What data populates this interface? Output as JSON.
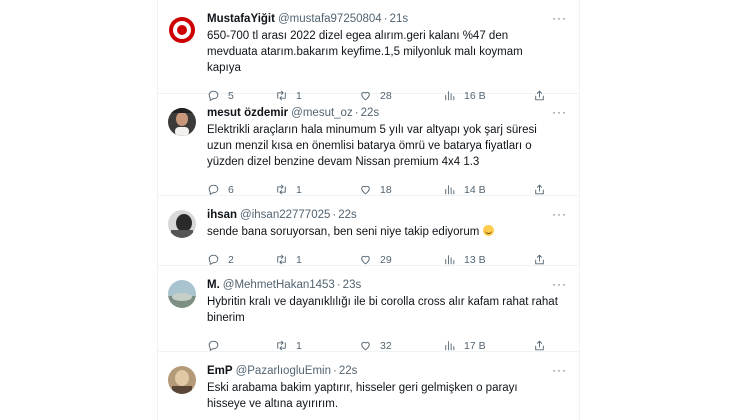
{
  "tweets": [
    {
      "name": "MustafaYiğit",
      "handle": "@mustafa97250804",
      "time": "21s",
      "text": "650-700 tl arası 2022 dizel egea alırım.geri kalanı %47 den mevduata atarım.bakarım keyfime.1,5 milyonluk malı koymam kapıya",
      "replies": "5",
      "retweets": "1",
      "likes": "28",
      "views": "16 B",
      "avatar": "target-logo"
    },
    {
      "name": "mesut özdemir",
      "handle": "@mesut_oz",
      "time": "22s",
      "text": "Elektrikli araçların hala minumum 5 yılı var altyapı yok şarj süresi uzun menzil kısa en önemlisi batarya ömrü ve batarya fiyatları o yüzden dizel benzine devam  Nissan premium 4x4 1.3",
      "replies": "6",
      "retweets": "1",
      "likes": "18",
      "views": "14 B",
      "avatar": "photo"
    },
    {
      "name": "ihsan",
      "handle": "@ihsan22777025",
      "time": "22s",
      "text": "sende bana soruyorsan, ben seni niye takip ediyorum",
      "emoji": "grinning-face",
      "replies": "2",
      "retweets": "1",
      "likes": "29",
      "views": "13 B",
      "avatar": "photo"
    },
    {
      "name": "M.",
      "handle": "@MehmetHakan1453",
      "time": "23s",
      "text": "Hybritin kralı ve dayanıklılığı ile bi corolla cross alır kafam rahat rahat binerim",
      "replies": "",
      "retweets": "1",
      "likes": "32",
      "views": "17 B",
      "avatar": "photo"
    },
    {
      "name": "EmP",
      "handle": "@PazarlıogluEmin",
      "time": "22s",
      "text": "Eski arabama bakim yaptırır, hisseler geri gelmişken o parayı hisseye ve altına ayırırım.",
      "avatar": "photo"
    }
  ],
  "colors": {
    "text": "#0f1419",
    "secondary": "#536471",
    "border": "#eff3f4",
    "target_red": "#cc0000"
  },
  "icons": [
    "reply-icon",
    "retweet-icon",
    "like-icon",
    "views-icon",
    "share-icon",
    "more-icon"
  ]
}
